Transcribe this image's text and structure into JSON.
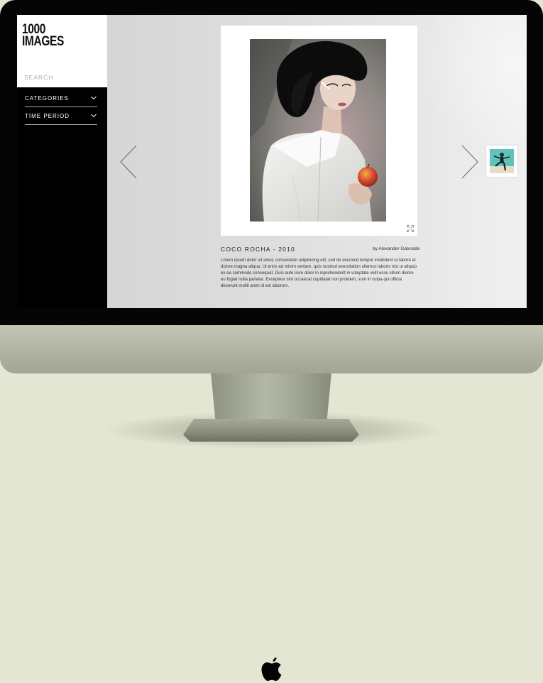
{
  "app": {
    "logo_text": "1000\nIMAGES",
    "search_placeholder": "SEARCH"
  },
  "sidebar": {
    "filters": [
      {
        "label": "CATEGORIES",
        "icon": "chevron-down-icon"
      },
      {
        "label": "TIME PERIOD",
        "icon": "chevron-down-icon"
      }
    ]
  },
  "viewer": {
    "prev_icon": "chevron-left-icon",
    "next_icon": "chevron-right-icon",
    "expand_icon": "expand-icon",
    "photo": {
      "title": "COCO ROCHA - 2010",
      "credit": "by Alexander Gatorade",
      "description": "Lorem ipsum dolor sit amet, consectetur adipisicing elit, sed do eiusmod tempor incididunt ut labore et dolore magna aliqua. Ut enim ad minim veniam, quis nostrud exercitation ullamco laboris nisi ut aliquip ex ea commodo consequat. Duis aute irure dolor in reprehenderit in voluptate velit esse cillum dolore eu fugiat nulla pariatur. Excepteur sint occaecat cupidatat non proident, sunt in culpa qui officia deserunt mollit anim id est laborum."
    }
  },
  "device": {
    "logo_icon": "apple-logo-icon"
  },
  "colors": {
    "bezel": "#050505",
    "background": "#e3e6d3",
    "chin": "#b3b6a4",
    "sidebar": "#000000"
  }
}
